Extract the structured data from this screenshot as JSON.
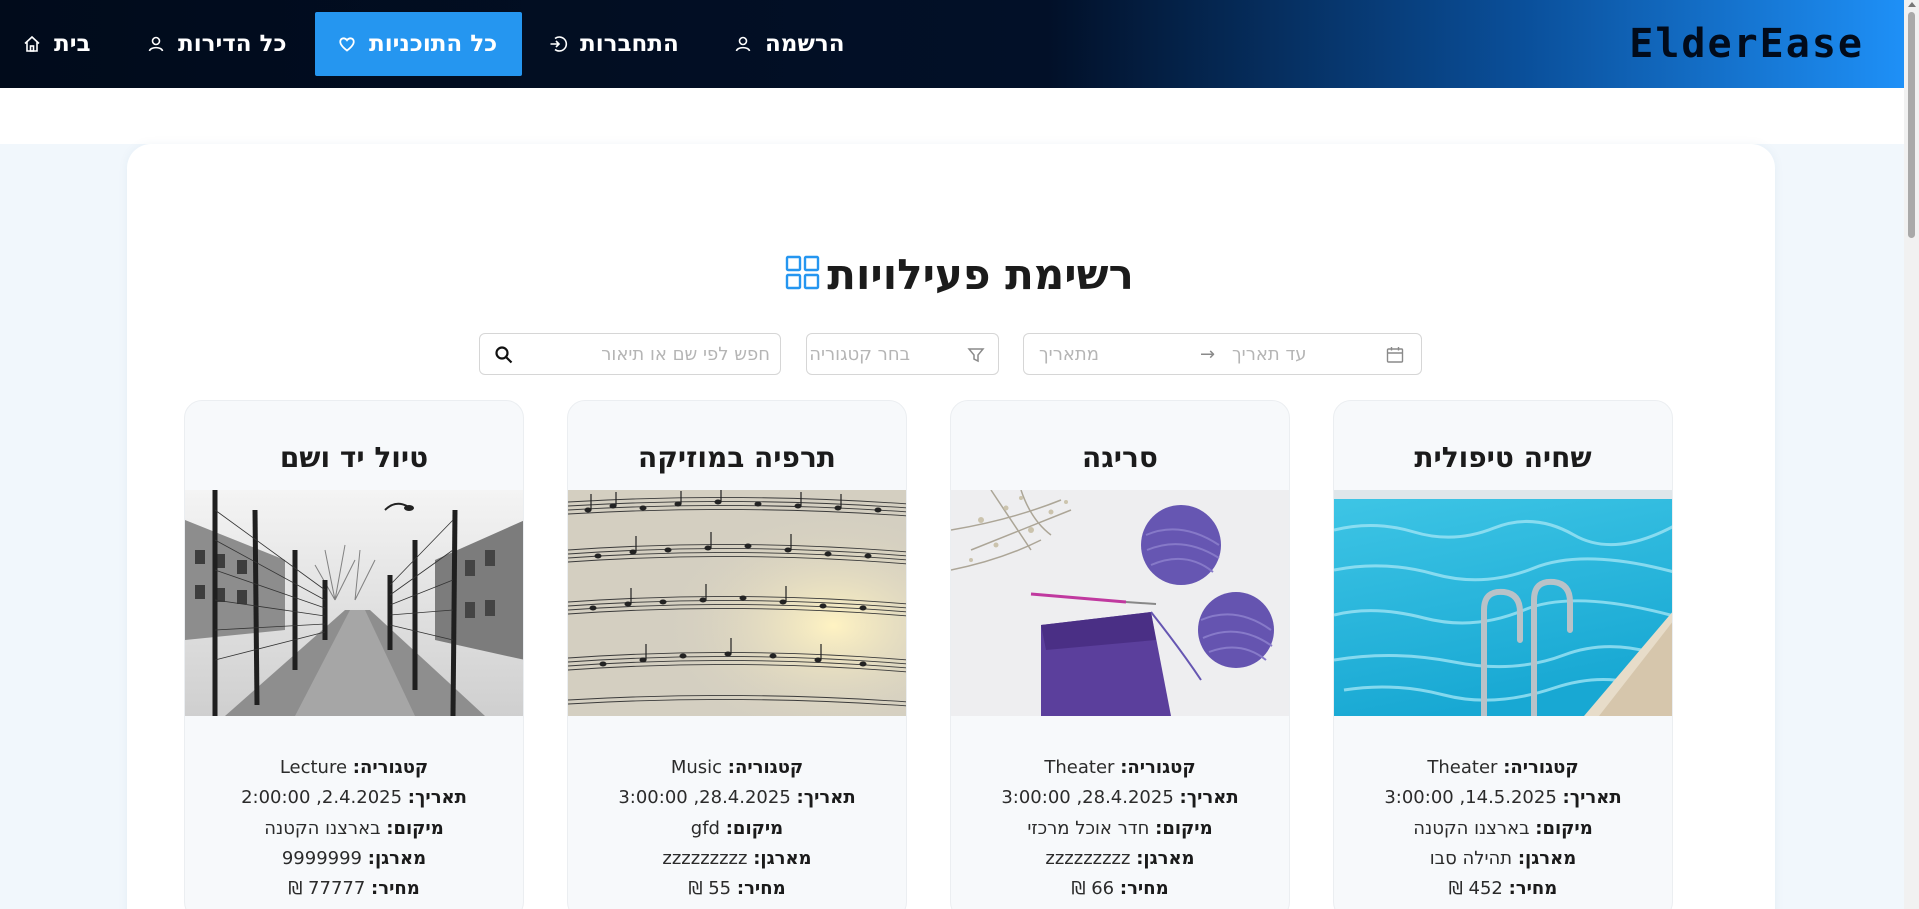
{
  "nav": {
    "logo": "ElderEase",
    "items": [
      {
        "label": "בית",
        "icon": "home-icon"
      },
      {
        "label": "כל הדירות",
        "icon": "user-icon"
      },
      {
        "label": "כל התוכניות",
        "icon": "heart-icon"
      },
      {
        "label": "התחברות",
        "icon": "login-icon"
      },
      {
        "label": "הרשמה",
        "icon": "user-icon"
      }
    ]
  },
  "page": {
    "title": "רשימת פעילויות"
  },
  "filters": {
    "search_placeholder": "חפש לפי שם או תיאור",
    "category_placeholder": "בחר קטגוריה",
    "date_to_placeholder": "עד תאריך",
    "date_from_placeholder": "מתאריך",
    "date_arrow": "→"
  },
  "labels": {
    "category": "קטגוריה:",
    "date": "תאריך:",
    "location": "מיקום:",
    "organizer": "מארגן:",
    "price": "מחיר:"
  },
  "cards": [
    {
      "title": "שחיה טיפולית",
      "category": "Theater",
      "date": "14.5.2025, 3:00:00",
      "location": "בארצנו הקטנה",
      "organizer": "תהילה סבו",
      "price": "452 ₪"
    },
    {
      "title": "סריגה",
      "category": "Theater",
      "date": "28.4.2025, 3:00:00",
      "location": "חדר אוכל מרכזי",
      "organizer": "zzzzzzzzz",
      "price": "66 ₪"
    },
    {
      "title": "תרפיה במוזיקה",
      "category": "Music",
      "date": "28.4.2025, 3:00:00",
      "location": "gfd",
      "organizer": "zzzzzzzzz",
      "price": "55 ₪"
    },
    {
      "title": "טיול יד ושם",
      "category": "Lecture",
      "date": "2.4.2025, 2:00:00",
      "location": "בארצנו הקטנה",
      "organizer": "9999999",
      "price": "77777 ₪"
    }
  ]
}
